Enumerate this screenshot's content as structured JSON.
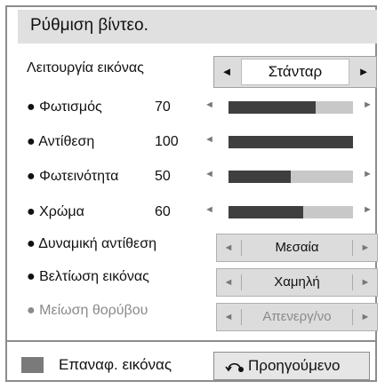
{
  "title": "Ρύθμιση βίντεο.",
  "picture_mode": {
    "label": "Λειτουργία εικόνας",
    "value": "Στάνταρ",
    "left_arrow": "◄",
    "right_arrow": "►"
  },
  "sliders": [
    {
      "label": "● Φωτισμός",
      "value": "70",
      "level": 0.7
    },
    {
      "label": "● Αντίθεση",
      "value": "100",
      "level": 1.0
    },
    {
      "label": "● Φωτεινότητα",
      "value": "50",
      "level": 0.5
    },
    {
      "label": "● Χρώμα",
      "value": "60",
      "level": 0.6
    }
  ],
  "slider_arrows": {
    "left": "◄",
    "right": "►"
  },
  "options": [
    {
      "label": "● Δυναμική αντίθεση",
      "value": "Μεσαία",
      "enabled": true
    },
    {
      "label": "● Βελτίωση εικόνας",
      "value": "Χαμηλή",
      "enabled": true
    },
    {
      "label": "● Μείωση θορύβου",
      "value": "Απενεργ/νο",
      "enabled": false
    }
  ],
  "footer": {
    "reset_label": "Επαναφ. εικόνας",
    "back_label": "Προηγούμενο"
  },
  "colors": {
    "title_bg": "#e0e0e0",
    "bar_fill": "#3f3f3f",
    "bar_track": "#c8c8c8",
    "border": "#8c8c8c",
    "reset_swatch": "#7a7a7a"
  }
}
